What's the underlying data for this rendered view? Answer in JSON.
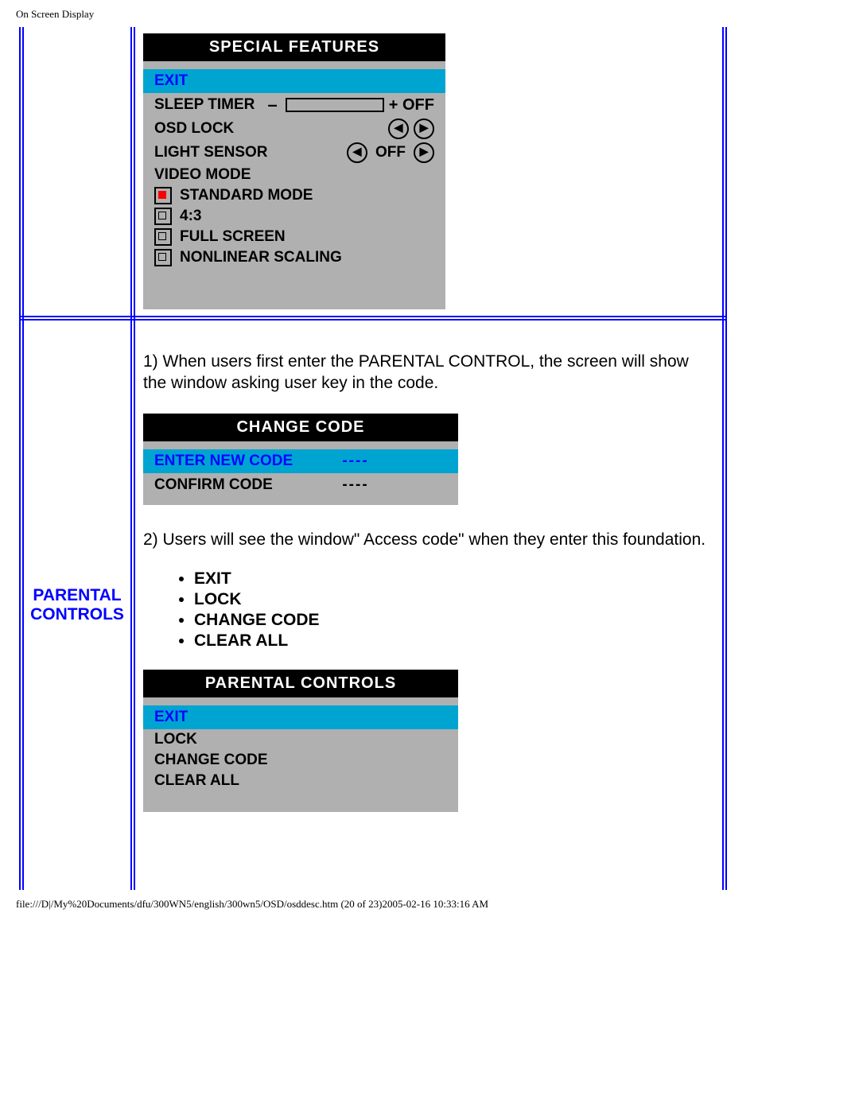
{
  "page_header": "On Screen Display",
  "page_footer": "file:///D|/My%20Documents/dfu/300WN5/english/300wn5/OSD/osddesc.htm (20 of 23)2005-02-16 10:33:16 AM",
  "section_label_line1": "PARENTAL",
  "section_label_line2": "CONTROLS",
  "special_features": {
    "title": "SPECIAL FEATURES",
    "exit": "EXIT",
    "sleep_timer": "SLEEP TIMER",
    "sleep_timer_value": "+ OFF",
    "osd_lock": "OSD LOCK",
    "light_sensor": "LIGHT SENSOR",
    "light_sensor_value": "OFF",
    "video_mode": "VIDEO MODE",
    "modes": {
      "standard": "STANDARD MODE",
      "ratio43": "4:3",
      "fullscreen": "FULL SCREEN",
      "nonlinear": "NONLINEAR SCALING"
    }
  },
  "paragraph1": "1) When users first enter the PARENTAL CONTROL, the screen will show the window asking user key in the code.",
  "change_code": {
    "title": "CHANGE CODE",
    "enter_new": "ENTER NEW CODE",
    "enter_new_val": "----",
    "confirm": "CONFIRM CODE",
    "confirm_val": "----"
  },
  "paragraph2": "2) Users will see the window\" Access code\" when they enter this foundation.",
  "options": [
    "EXIT",
    "LOCK",
    "CHANGE CODE",
    "CLEAR ALL"
  ],
  "parental_panel": {
    "title": "PARENTAL CONTROLS",
    "exit": "EXIT",
    "lock": "LOCK",
    "change_code": "CHANGE CODE",
    "clear_all": "CLEAR ALL"
  }
}
